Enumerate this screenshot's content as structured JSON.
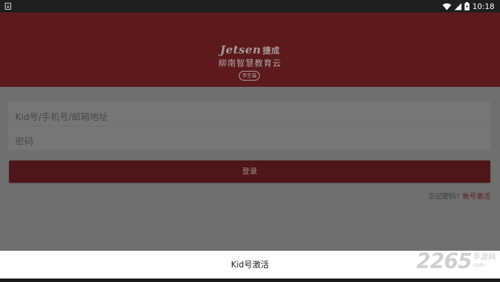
{
  "status_bar": {
    "time": "10:18",
    "notification_icon": "app-notification-icon",
    "icons": [
      "wifi-icon",
      "cell-signal-icon",
      "battery-icon"
    ]
  },
  "header": {
    "logo_text": "Jetsen",
    "logo_cn": "捷成",
    "subtitle": "柳南智慧教育云",
    "badge": "学生端",
    "color": "#5c1a1c"
  },
  "form": {
    "account_placeholder": "Kid号/手机号/邮箱地址",
    "password_placeholder": "密码"
  },
  "login_button": "登录",
  "links": {
    "forgot": "忘记密码?",
    "activate": "帐号激活"
  },
  "sheet": {
    "item": "Kid号激活"
  },
  "watermark": {
    "number": "2265",
    "text": "手游网",
    "domain": "com"
  }
}
